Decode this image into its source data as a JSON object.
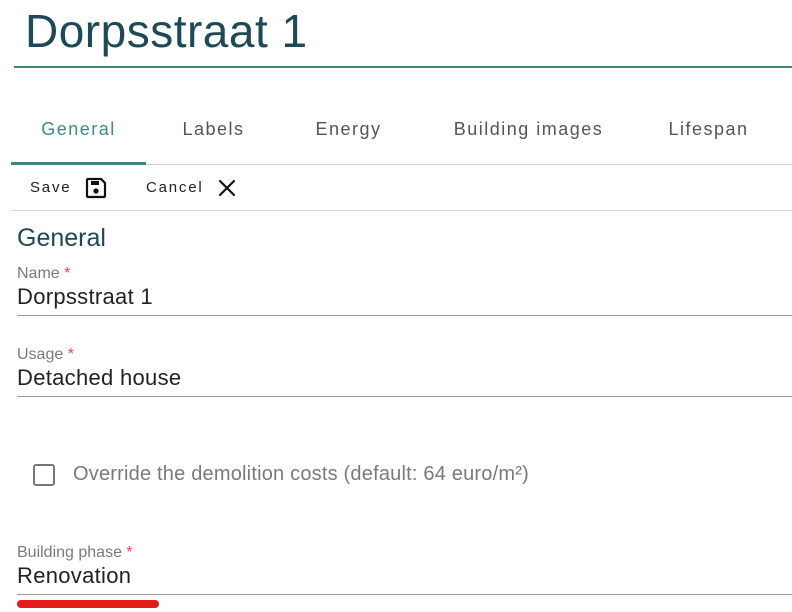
{
  "header": {
    "title": "Dorpsstraat 1"
  },
  "tabs": [
    {
      "label": "General",
      "active": true
    },
    {
      "label": "Labels",
      "active": false
    },
    {
      "label": "Energy",
      "active": false
    },
    {
      "label": "Building images",
      "active": false
    },
    {
      "label": "Lifespan",
      "active": false
    }
  ],
  "toolbar": {
    "save_label": "Save",
    "save_icon": "save-icon",
    "cancel_label": "Cancel",
    "cancel_icon": "close-icon"
  },
  "section": {
    "title": "General"
  },
  "fields": {
    "name": {
      "label": "Name",
      "required_mark": "*",
      "value": "Dorpsstraat 1"
    },
    "usage": {
      "label": "Usage",
      "required_mark": "*",
      "value": "Detached house"
    },
    "building_phase": {
      "label": "Building phase",
      "required_mark": "*",
      "value": "Renovation"
    }
  },
  "override_demolition": {
    "label": "Override the demolition costs (default: 64 euro/m²)",
    "checked": false
  },
  "colors": {
    "accent": "#3d8582",
    "title": "#1d4a56",
    "required": "#e84a4a",
    "annotation_underline": "#e31b1b"
  }
}
